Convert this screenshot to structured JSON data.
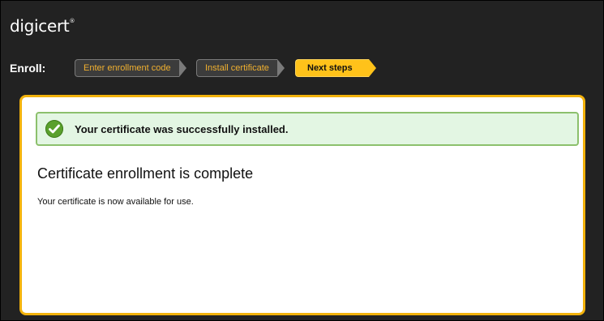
{
  "app": {
    "logo_text": "digicert",
    "logo_mark": "®"
  },
  "enroll": {
    "label": "Enroll:",
    "steps": [
      {
        "label": "Enter enrollment code",
        "state": "done"
      },
      {
        "label": "Install certificate",
        "state": "done"
      },
      {
        "label": "Next steps",
        "state": "current"
      }
    ]
  },
  "alert": {
    "icon": "check-circle-icon",
    "text": "Your certificate was successfully installed.",
    "color": "#5aa02c"
  },
  "content": {
    "heading": "Certificate enrollment is complete",
    "body": "Your certificate is now available for use."
  },
  "colors": {
    "accent": "#f2b20c",
    "background": "#222222",
    "success_bg": "#e3f6e3"
  }
}
